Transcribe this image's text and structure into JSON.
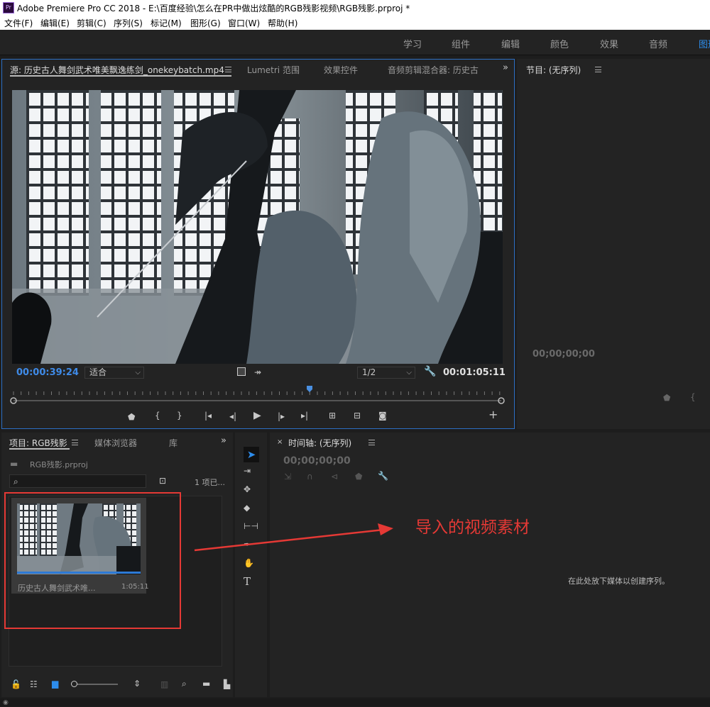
{
  "titlebar": {
    "app_icon": "Pr",
    "title": "Adobe Premiere Pro CC 2018 - E:\\百度经验\\怎么在PR中做出炫酷的RGB残影视频\\RGB残影.prproj *"
  },
  "menu": [
    "文件(F)",
    "编辑(E)",
    "剪辑(C)",
    "序列(S)",
    "标记(M)",
    "图形(G)",
    "窗口(W)",
    "帮助(H)"
  ],
  "workspaces": [
    "学习",
    "组件",
    "编辑",
    "颜色",
    "效果",
    "音频",
    "图形"
  ],
  "source_panel": {
    "tabs": [
      "源: 历史古人舞剑武术唯美飘逸练剑_onekeybatch.mp4",
      "Lumetri 范围",
      "效果控件",
      "音频剪辑混合器: 历史古"
    ],
    "current_time": "00:00:39:24",
    "zoom": "适合",
    "resolution": "1/2",
    "duration": "00:01:05:11",
    "playhead_fraction": 0.607
  },
  "program_panel": {
    "title": "节目: (无序列)",
    "timecode": "00;00;00;00"
  },
  "project_panel": {
    "tabs": [
      "项目: RGB残影",
      "媒体浏览器",
      "库"
    ],
    "project_file": "RGB残影.prproj",
    "item_count": "1 项已...",
    "clip": {
      "name": "历史古人舞剑武术唯...",
      "duration": "1:05:11"
    }
  },
  "timeline_panel": {
    "title": "时间轴: (无序列)",
    "timecode": "00;00;00;00",
    "drop_hint": "在此处放下媒体以创建序列。"
  },
  "annotation": {
    "text": "导入的视频素材",
    "color": "#e53935"
  },
  "icons": {
    "selection": "selection-tool-icon",
    "track_select": "track-select-icon",
    "ripple": "ripple-edit-icon",
    "razor": "razor-icon",
    "slip": "slip-icon",
    "pen": "pen-icon",
    "hand": "hand-icon",
    "type": "type-icon"
  }
}
